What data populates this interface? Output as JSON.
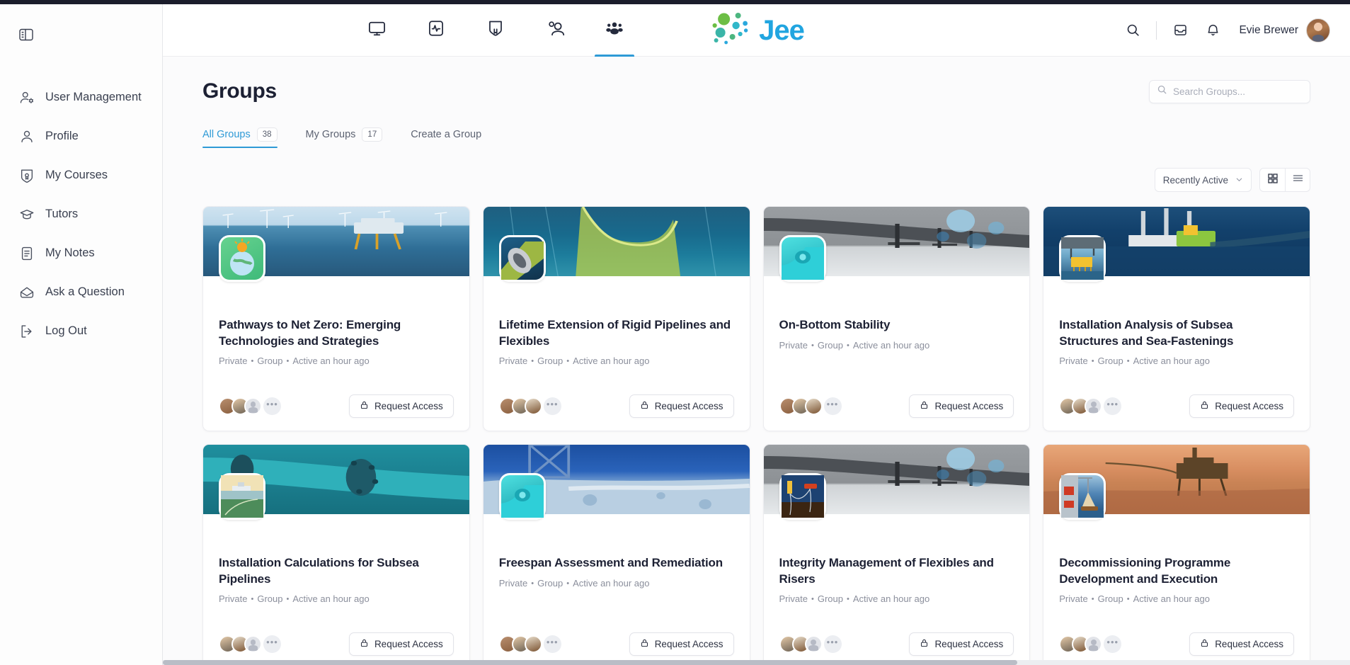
{
  "sidebar": {
    "toggle_icon": "panel-toggle-icon",
    "items": [
      {
        "label": "User Management",
        "icon": "user-settings-icon"
      },
      {
        "label": "Profile",
        "icon": "user-icon"
      },
      {
        "label": "My Courses",
        "icon": "course-badge-icon"
      },
      {
        "label": "Tutors",
        "icon": "graduation-cap-icon"
      },
      {
        "label": "My Notes",
        "icon": "note-icon"
      },
      {
        "label": "Ask a Question",
        "icon": "envelope-icon"
      },
      {
        "label": "Log Out",
        "icon": "logout-icon"
      }
    ]
  },
  "header": {
    "nav": [
      {
        "name": "dashboard",
        "icon": "monitor-icon",
        "active": false
      },
      {
        "name": "activity",
        "icon": "activity-pulse-icon",
        "active": false
      },
      {
        "name": "courses",
        "icon": "course-badge-icon",
        "active": false
      },
      {
        "name": "people",
        "icon": "users-icon",
        "active": false
      },
      {
        "name": "groups",
        "icon": "group-people-icon",
        "active": true
      }
    ],
    "logo_text": "Jee",
    "logo_color": "#21a5e0",
    "logo_dot_colors": [
      "#6cbe45",
      "#4cb680",
      "#3bb5a8",
      "#31b7c9",
      "#2aa8dd"
    ],
    "actions": [
      {
        "name": "search",
        "icon": "search-icon"
      },
      {
        "name": "inbox",
        "icon": "inbox-icon"
      },
      {
        "name": "notifications",
        "icon": "bell-icon"
      }
    ],
    "user_name": "Evie Brewer"
  },
  "page": {
    "title": "Groups",
    "search": {
      "placeholder": "Search Groups...",
      "value": ""
    },
    "tabs": [
      {
        "label": "All Groups",
        "badge": "38",
        "active": true
      },
      {
        "label": "My Groups",
        "badge": "17",
        "active": false
      },
      {
        "label": "Create a Group",
        "badge": "",
        "active": false
      }
    ],
    "sort": {
      "label": "Recently Active"
    },
    "view_modes": [
      {
        "name": "grid-view",
        "icon": "grid-icon",
        "active": true
      },
      {
        "name": "list-view",
        "icon": "list-icon",
        "active": false
      }
    ]
  },
  "accent_color": "#2e9ad6",
  "groups": [
    {
      "title": "Pathways to Net Zero: Emerging Technologies and Strategies",
      "privacy": "Private",
      "type": "Group",
      "activity": "Active an hour ago",
      "action_label": "Request Access",
      "action_icon": "lock-icon",
      "members_shown": 2,
      "has_placeholder_member": true,
      "more_label": "•••",
      "cover_style": "offshore-wind-farm",
      "badge_style": "net-zero-globe"
    },
    {
      "title": "Lifetime Extension of Rigid Pipelines and Flexibles",
      "privacy": "Private",
      "type": "Group",
      "activity": "Active an hour ago",
      "action_label": "Request Access",
      "action_icon": "lock-icon",
      "members_shown": 3,
      "has_placeholder_member": false,
      "more_label": "•••",
      "cover_style": "subsea-cable-deep-blue",
      "badge_style": "pipeline-cross-section"
    },
    {
      "title": "On-Bottom Stability",
      "privacy": "Private",
      "type": "Group",
      "activity": "Active an hour ago",
      "action_label": "Request Access",
      "action_icon": "lock-icon",
      "members_shown": 3,
      "has_placeholder_member": false,
      "more_label": "•••",
      "cover_style": "grey-pipeline-shore",
      "badge_style": "teal-pipe-joint"
    },
    {
      "title": "Installation Analysis of Subsea Structures and Sea-Fastenings",
      "privacy": "Private",
      "type": "Group",
      "activity": "Active an hour ago",
      "action_label": "Request Access",
      "action_icon": "lock-icon",
      "members_shown": 2,
      "has_placeholder_member": true,
      "more_label": "•••",
      "cover_style": "jackup-rig-vessel",
      "badge_style": "subsea-lift"
    },
    {
      "title": "Installation Calculations for Subsea Pipelines",
      "privacy": "Private",
      "type": "Group",
      "activity": "Active an hour ago",
      "action_label": "Request Access",
      "action_icon": "lock-icon",
      "members_shown": 2,
      "has_placeholder_member": true,
      "more_label": "•••",
      "cover_style": "teal-pipeline-flange",
      "badge_style": "sunset-lay-vessel"
    },
    {
      "title": "Freespan Assessment and Remediation",
      "privacy": "Private",
      "type": "Group",
      "activity": "Active an hour ago",
      "action_label": "Request Access",
      "action_icon": "lock-icon",
      "members_shown": 3,
      "has_placeholder_member": false,
      "more_label": "•••",
      "cover_style": "rocky-seabed-blue",
      "badge_style": "teal-pipe-joint"
    },
    {
      "title": "Integrity Management of Flexibles and Risers",
      "privacy": "Private",
      "type": "Group",
      "activity": "Active an hour ago",
      "action_label": "Request Access",
      "action_icon": "lock-icon",
      "members_shown": 2,
      "has_placeholder_member": true,
      "more_label": "•••",
      "cover_style": "grey-pipeline-shore",
      "badge_style": "riser-night-rig"
    },
    {
      "title": "Decommissioning Programme Development and Execution",
      "privacy": "Private",
      "type": "Group",
      "activity": "Active an hour ago",
      "action_label": "Request Access",
      "action_icon": "lock-icon",
      "members_shown": 2,
      "has_placeholder_member": true,
      "more_label": "•••",
      "cover_style": "sunset-platform",
      "badge_style": "lifeboat-davit"
    }
  ]
}
